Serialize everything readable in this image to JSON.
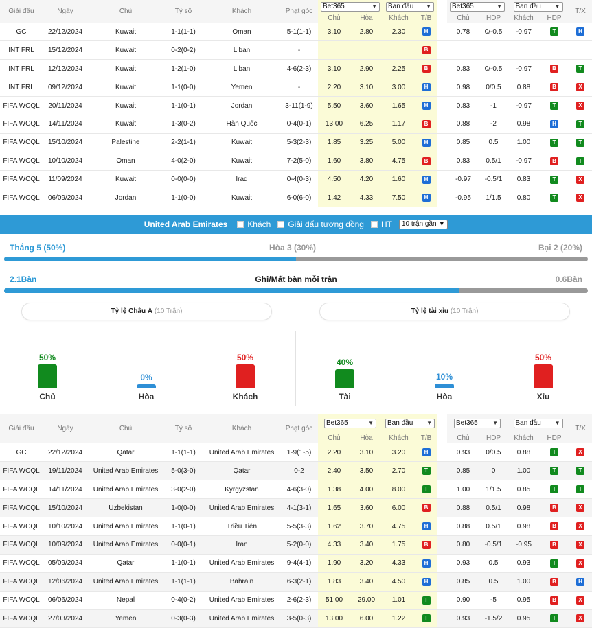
{
  "table_headers": {
    "league": "Giải đấu",
    "date": "Ngày",
    "home": "Chủ",
    "score": "Tỷ số",
    "away": "Khách",
    "corner": "Phạt góc",
    "bookmaker": "Bet365",
    "initial": "Ban đầu",
    "home_odds": "Chủ",
    "draw_odds": "Hòa",
    "away_odds": "Khách",
    "wl": "T/B",
    "hc_home": "Chủ",
    "hdp": "HDP",
    "hc_away": "Khách",
    "hdp_res": "HDP",
    "ou": "T/X"
  },
  "kuwait_matches": [
    {
      "league": "GC",
      "date": "22/12/2024",
      "home": "Kuwait",
      "score": "1-1(1-1)",
      "away": "Oman",
      "corner": "5-1(1-1)",
      "o1": "3.10",
      "ox": "2.80",
      "o2": "2.30",
      "wl": "H",
      "h1": "0.78",
      "hdp": "0/-0.5",
      "h2": "-0.97",
      "hr": "T",
      "ou": "H",
      "focus": "home"
    },
    {
      "league": "INT FRL",
      "date": "15/12/2024",
      "home": "Kuwait",
      "score": "0-2(0-2)",
      "away": "Liban",
      "corner": "-",
      "o1": "",
      "ox": "",
      "o2": "",
      "wl": "B",
      "h1": "",
      "hdp": "",
      "h2": "",
      "hr": "",
      "ou": "",
      "focus": "home"
    },
    {
      "league": "INT FRL",
      "date": "12/12/2024",
      "home": "Kuwait",
      "score": "1-2(1-0)",
      "away": "Liban",
      "corner": "4-6(2-3)",
      "o1": "3.10",
      "ox": "2.90",
      "o2": "2.25",
      "wl": "B",
      "h1": "0.83",
      "hdp": "0/-0.5",
      "h2": "-0.97",
      "hr": "B",
      "ou": "T",
      "focus": "home"
    },
    {
      "league": "INT FRL",
      "date": "09/12/2024",
      "home": "Kuwait",
      "score": "1-1(0-0)",
      "away": "Yemen",
      "corner": "-",
      "o1": "2.20",
      "ox": "3.10",
      "o2": "3.00",
      "wl": "H",
      "h1": "0.98",
      "hdp": "0/0.5",
      "h2": "0.88",
      "hr": "B",
      "ou": "X",
      "focus": "home"
    },
    {
      "league": "FIFA WCQL",
      "date": "20/11/2024",
      "home": "Kuwait",
      "score": "1-1(0-1)",
      "away": "Jordan",
      "corner": "3-11(1-9)",
      "o1": "5.50",
      "ox": "3.60",
      "o2": "1.65",
      "wl": "H",
      "h1": "0.83",
      "hdp": "-1",
      "h2": "-0.97",
      "hr": "T",
      "ou": "X",
      "focus": "home"
    },
    {
      "league": "FIFA WCQL",
      "date": "14/11/2024",
      "home": "Kuwait",
      "score": "1-3(0-2)",
      "away": "Hàn Quốc",
      "corner": "0-4(0-1)",
      "o1": "13.00",
      "ox": "6.25",
      "o2": "1.17",
      "wl": "B",
      "h1": "0.88",
      "hdp": "-2",
      "h2": "0.98",
      "hr": "H",
      "ou": "T",
      "focus": "home"
    },
    {
      "league": "FIFA WCQL",
      "date": "15/10/2024",
      "home": "Palestine",
      "score": "2-2(1-1)",
      "away": "Kuwait",
      "corner": "5-3(2-3)",
      "o1": "1.85",
      "ox": "3.25",
      "o2": "5.00",
      "wl": "H",
      "h1": "0.85",
      "hdp": "0.5",
      "h2": "1.00",
      "hr": "T",
      "ou": "T",
      "focus": "away"
    },
    {
      "league": "FIFA WCQL",
      "date": "10/10/2024",
      "home": "Oman",
      "score": "4-0(2-0)",
      "away": "Kuwait",
      "corner": "7-2(5-0)",
      "o1": "1.60",
      "ox": "3.80",
      "o2": "4.75",
      "wl": "B",
      "h1": "0.83",
      "hdp": "0.5/1",
      "h2": "-0.97",
      "hr": "B",
      "ou": "T",
      "focus": "away"
    },
    {
      "league": "FIFA WCQL",
      "date": "11/09/2024",
      "home": "Kuwait",
      "score": "0-0(0-0)",
      "away": "Iraq",
      "corner": "0-4(0-3)",
      "o1": "4.50",
      "ox": "4.20",
      "o2": "1.60",
      "wl": "H",
      "h1": "-0.97",
      "hdp": "-0.5/1",
      "h2": "0.83",
      "hr": "T",
      "ou": "X",
      "focus": "home"
    },
    {
      "league": "FIFA WCQL",
      "date": "06/09/2024",
      "home": "Jordan",
      "score": "1-1(0-0)",
      "away": "Kuwait",
      "corner": "6-0(6-0)",
      "o1": "1.42",
      "ox": "4.33",
      "o2": "7.50",
      "wl": "H",
      "h1": "-0.95",
      "hdp": "1/1.5",
      "h2": "0.80",
      "hr": "T",
      "ou": "X",
      "focus": "away"
    }
  ],
  "band": {
    "team": "United Arab Emirates",
    "opt_away": "Khách",
    "opt_same_league": "Giải đấu tương đồng",
    "opt_ht": "HT",
    "recent_select": "10 trận gần"
  },
  "summary": {
    "win_text": "Thắng 5 (50%)",
    "draw_text": "Hòa 3 (30%)",
    "loss_text": "Bại 2 (20%)",
    "win_pct": 50,
    "draw_pct": 30,
    "goals_for": "2.1Bàn",
    "goals_label": "Ghi/Mất bàn mỗi trận",
    "goals_against": "0.6Bàn",
    "goals_ratio": 0.78
  },
  "asian": {
    "title": "Tỷ lệ Châu Á",
    "count": "(10 Trận)",
    "items": [
      {
        "pct_text": "50%",
        "pct": 50,
        "label": "Chủ",
        "color": "#118a1e"
      },
      {
        "pct_text": "0%",
        "pct": 0,
        "label": "Hòa",
        "color": "#2e8fd6"
      },
      {
        "pct_text": "50%",
        "pct": 50,
        "label": "Khách",
        "color": "#e02020"
      }
    ]
  },
  "overunder": {
    "title": "Tỷ lệ tài xỉu",
    "count": "(10 Trận)",
    "items": [
      {
        "pct_text": "40%",
        "pct": 40,
        "label": "Tài",
        "color": "#118a1e"
      },
      {
        "pct_text": "10%",
        "pct": 10,
        "label": "Hòa",
        "color": "#2e8fd6"
      },
      {
        "pct_text": "50%",
        "pct": 50,
        "label": "Xỉu",
        "color": "#e02020"
      }
    ]
  },
  "uae_matches": [
    {
      "league": "GC",
      "date": "22/12/2024",
      "home": "Qatar",
      "score": "1-1(1-1)",
      "away": "United Arab Emirates",
      "corner": "1-9(1-5)",
      "o1": "2.20",
      "ox": "3.10",
      "o2": "3.20",
      "wl": "H",
      "h1": "0.93",
      "hdp": "0/0.5",
      "h2": "0.88",
      "hr": "T",
      "ou": "X",
      "focus": "away"
    },
    {
      "league": "FIFA WCQL",
      "date": "19/11/2024",
      "home": "United Arab Emirates",
      "score": "5-0(3-0)",
      "away": "Qatar",
      "corner": "0-2",
      "o1": "2.40",
      "ox": "3.50",
      "o2": "2.70",
      "wl": "T",
      "h1": "0.85",
      "hdp": "0",
      "h2": "1.00",
      "hr": "T",
      "ou": "T",
      "focus": "home"
    },
    {
      "league": "FIFA WCQL",
      "date": "14/11/2024",
      "home": "United Arab Emirates",
      "score": "3-0(2-0)",
      "away": "Kyrgyzstan",
      "corner": "4-6(3-0)",
      "o1": "1.38",
      "ox": "4.00",
      "o2": "8.00",
      "wl": "T",
      "h1": "1.00",
      "hdp": "1/1.5",
      "h2": "0.85",
      "hr": "T",
      "ou": "T",
      "focus": "home"
    },
    {
      "league": "FIFA WCQL",
      "date": "15/10/2024",
      "home": "Uzbekistan",
      "score": "1-0(0-0)",
      "away": "United Arab Emirates",
      "corner": "4-1(3-1)",
      "o1": "1.65",
      "ox": "3.60",
      "o2": "6.00",
      "wl": "B",
      "h1": "0.88",
      "hdp": "0.5/1",
      "h2": "0.98",
      "hr": "B",
      "ou": "X",
      "focus": "away"
    },
    {
      "league": "FIFA WCQL",
      "date": "10/10/2024",
      "home": "United Arab Emirates",
      "score": "1-1(0-1)",
      "away": "Triều Tiên",
      "corner": "5-5(3-3)",
      "o1": "1.62",
      "ox": "3.70",
      "o2": "4.75",
      "wl": "H",
      "h1": "0.88",
      "hdp": "0.5/1",
      "h2": "0.98",
      "hr": "B",
      "ou": "X",
      "focus": "home"
    },
    {
      "league": "FIFA WCQL",
      "date": "10/09/2024",
      "home": "United Arab Emirates",
      "score": "0-0(0-1)",
      "away": "Iran",
      "corner": "5-2(0-0)",
      "o1": "4.33",
      "ox": "3.40",
      "o2": "1.75",
      "wl": "B",
      "h1": "0.80",
      "hdp": "-0.5/1",
      "h2": "-0.95",
      "hr": "B",
      "ou": "X",
      "focus": "home"
    },
    {
      "league": "FIFA WCQL",
      "date": "05/09/2024",
      "home": "Qatar",
      "score": "1-1(0-1)",
      "away": "United Arab Emirates",
      "corner": "9-4(4-1)",
      "o1": "1.90",
      "ox": "3.20",
      "o2": "4.33",
      "wl": "H",
      "h1": "0.93",
      "hdp": "0.5",
      "h2": "0.93",
      "hr": "T",
      "ou": "X",
      "focus": "away"
    },
    {
      "league": "FIFA WCQL",
      "date": "12/06/2024",
      "home": "United Arab Emirates",
      "score": "1-1(1-1)",
      "away": "Bahrain",
      "corner": "6-3(2-1)",
      "o1": "1.83",
      "ox": "3.40",
      "o2": "4.50",
      "wl": "H",
      "h1": "0.85",
      "hdp": "0.5",
      "h2": "1.00",
      "hr": "B",
      "ou": "H",
      "focus": "home"
    },
    {
      "league": "FIFA WCQL",
      "date": "06/06/2024",
      "home": "Nepal",
      "score": "0-4(0-2)",
      "away": "United Arab Emirates",
      "corner": "2-6(2-3)",
      "o1": "51.00",
      "ox": "29.00",
      "o2": "1.01",
      "wl": "T",
      "h1": "0.90",
      "hdp": "-5",
      "h2": "0.95",
      "hr": "B",
      "ou": "X",
      "focus": "away"
    },
    {
      "league": "FIFA WCQL",
      "date": "27/03/2024",
      "home": "Yemen",
      "score": "0-3(0-3)",
      "away": "United Arab Emirates",
      "corner": "3-5(0-3)",
      "o1": "13.00",
      "ox": "6.00",
      "o2": "1.22",
      "wl": "T",
      "h1": "0.93",
      "hdp": "-1.5/2",
      "h2": "0.95",
      "hr": "T",
      "ou": "X",
      "focus": "away"
    }
  ],
  "colors": {
    "band_blue": "#2e9ad6",
    "team_a_orange": "#e05d2a",
    "team_b_blue": "#2b7fc1",
    "score_red": "#c0392b",
    "odds_yellow": "#fbfbd7",
    "badge_H": "#1e6ed6",
    "badge_B": "#e02020",
    "badge_T": "#118a1e",
    "badge_X": "#e02020"
  }
}
